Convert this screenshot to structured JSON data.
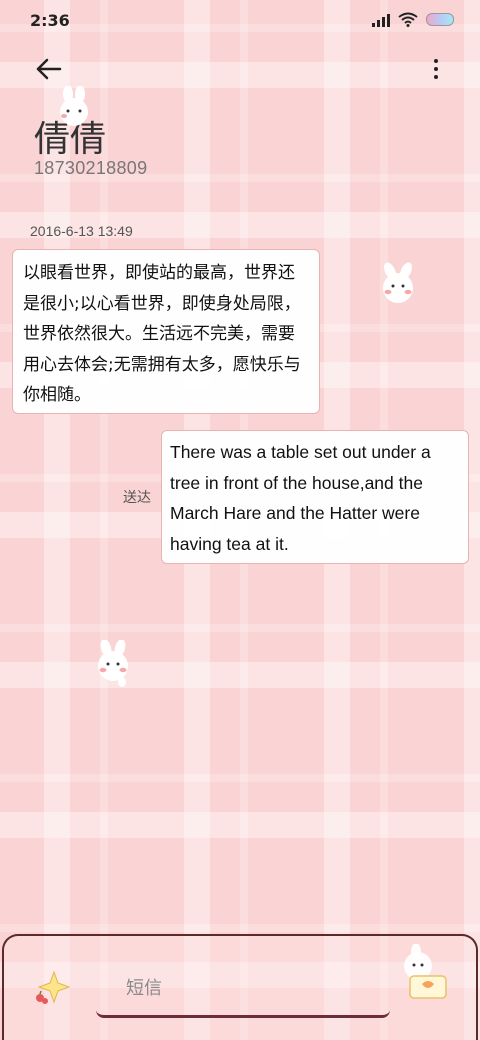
{
  "status_bar": {
    "time": "2:36"
  },
  "header": {
    "contact_name": "倩倩",
    "contact_number": "18730218809"
  },
  "conversation": {
    "timestamp": "2016-6-13 13:49",
    "incoming_message": "以眼看世界，即使站的最高，世界还是很小;以心看世界，即使身处局限，世界依然很大。生活远不完美，需要用心去体会;无需拥有太多，愿快乐与你相随。",
    "outgoing_message": "There was a table set out under a tree in front of the house,and the March Hare and the Hatter were having tea at it.",
    "outgoing_status": "送达"
  },
  "compose": {
    "placeholder": "短信"
  },
  "icons": {
    "back": "arrow-left-icon",
    "menu": "more-vertical-icon",
    "emoji": "sparkle-icon",
    "send": "send-icon",
    "wifi": "wifi-icon",
    "signal": "signal-icon",
    "battery": "battery-icon"
  },
  "colors": {
    "background": "#fad4d4",
    "bubble_border": "#e7b3b3",
    "compose_border": "#5b2a2a"
  }
}
